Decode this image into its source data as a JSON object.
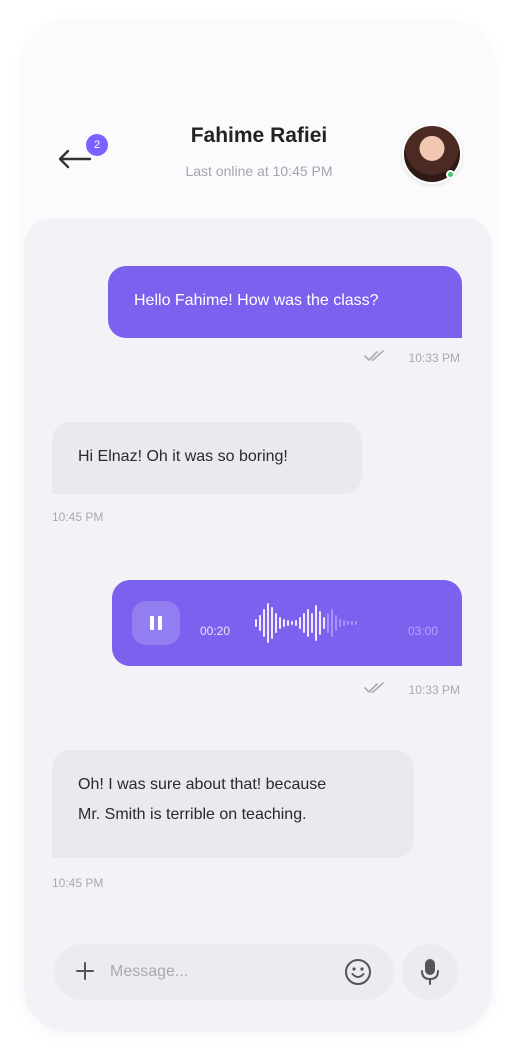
{
  "header": {
    "back_badge": "2",
    "contact_name": "Fahime Rafiei",
    "last_online": "Last online at 10:45 PM",
    "avatar_icon": "contact-avatar"
  },
  "messages": [
    {
      "direction": "sent",
      "text": "Hello Fahime! How was the class?",
      "time": "10:33 PM",
      "status": "read"
    },
    {
      "direction": "received",
      "text": "Hi Elnaz! Oh it was so boring!",
      "time": "10:45 PM"
    },
    {
      "direction": "sent",
      "type": "voice",
      "current": "00:20",
      "duration": "03:00",
      "playing": true,
      "time": "10:33 PM",
      "status": "read"
    },
    {
      "direction": "received",
      "text_line1": "Oh! I was sure about that! because",
      "text_line2": "Mr. Smith is terrible on teaching.",
      "time": "10:45 PM"
    }
  ],
  "composer": {
    "placeholder": "Message...",
    "plus_icon": "plus-icon",
    "emoji_icon": "smile-icon",
    "mic_icon": "microphone-icon"
  },
  "colors": {
    "accent": "#7b61ee",
    "received_bubble": "#e9e9ee",
    "chat_background": "#f3f3f7",
    "online": "#3ec46d"
  }
}
